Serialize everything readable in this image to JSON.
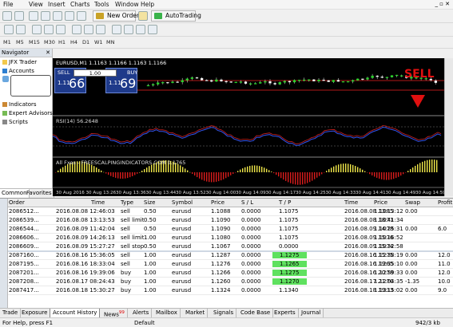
{
  "menu": [
    "File",
    "View",
    "Insert",
    "Charts",
    "Tools",
    "Window",
    "Help"
  ],
  "toolbar": {
    "new_order": "New Order",
    "autotrading": "AutoTrading",
    "timeframes": [
      "M1",
      "M5",
      "M15",
      "M30",
      "H1",
      "H4",
      "D1",
      "W1",
      "MN"
    ]
  },
  "navigator": {
    "title": "Navigator",
    "items": [
      "JFX Trader",
      "Accounts",
      "Indicators",
      "Expert Advisors",
      "Scripts"
    ],
    "tabs": [
      "Common",
      "Favorites"
    ]
  },
  "chart": {
    "title": "EURUSD,M1  1.1163 1.1166 1.1163 1.1166",
    "sell_label": "SELL",
    "buy_label": "BUY",
    "lot": "1.00",
    "sell_small": "1.11",
    "sell_big": "66",
    "buy_small": "1.11",
    "buy_big": "69",
    "signal_text": "SELL",
    "rsi_label": "RSI(14) 56.2648",
    "ind_label": "All Fxes - FREESCALPINGINDICATORS.COM  0.1765",
    "time_labels": [
      "30 Aug 2016",
      "30 Aug 13:26",
      "30 Aug 13:36",
      "30 Aug 13:44",
      "30 Aug 13:52",
      "30 Aug 14:00",
      "30 Aug 14:09",
      "30 Aug 14:17",
      "30 Aug 14:25",
      "30 Aug 14:33",
      "30 Aug 14:41",
      "30 Aug 14:49",
      "30 Aug 14:59"
    ],
    "accent_up": "#2bd52b",
    "accent_down": "#e01010",
    "signal_color": "#e01010"
  },
  "terminal": {
    "columns": [
      "Order",
      "Time",
      "Type",
      "Size",
      "Symbol",
      "Price",
      "S / L",
      "T / P",
      "Time",
      "Price",
      "Swap",
      "Profit"
    ],
    "rows": [
      [
        "2086512...",
        "2016.08.08 12:46:03",
        "sell",
        "0.50",
        "eurusd",
        "1.1088",
        "0.0000",
        "1.1075",
        "2016.08.08 13:13:12",
        "1.1085",
        "0.00",
        ""
      ],
      [
        "2086539...",
        "2016.08.08 13:13:53",
        "sell limit",
        "0.50",
        "eurusd",
        "1.1090",
        "0.0000",
        "1.1075",
        "2016.08.08 18:41:34",
        "1.1071",
        "",
        ""
      ],
      [
        "2086544...",
        "2016.08.09 11:42:04",
        "sell",
        "0.50",
        "eurusd",
        "1.1090",
        "0.0000",
        "1.1075",
        "2016.08.09 14:25:31",
        "1.1078",
        "0.00",
        "6.0"
      ],
      [
        "2086606...",
        "2016.08.09 14:26:13",
        "sell limit",
        "1.00",
        "eurusd",
        "1.1080",
        "0.0000",
        "1.1075",
        "2016.08.09 15:16:52",
        "1.1076",
        "",
        ""
      ],
      [
        "2086609...",
        "2016.08.09 15:27:27",
        "sell stop",
        "0.50",
        "eurusd",
        "1.1067",
        "0.0000",
        "0.0000",
        "2016.08.09 15:32:58",
        "1.1074",
        "",
        ""
      ],
      [
        "2087160...",
        "2016.08.16 15:36:05",
        "sell",
        "1.00",
        "eurusd",
        "1.1287",
        "0.0000",
        "1.1275",
        "2016.08.16 15:38:19",
        "1.1275",
        "0.00",
        "12.0"
      ],
      [
        "2087195...",
        "2016.08.16 18:33:04",
        "sell",
        "1.00",
        "eurusd",
        "1.1276",
        "0.0000",
        "1.1265",
        "2016.08.16 19:35:10",
        "1.1265",
        "0.00",
        "11.0"
      ],
      [
        "2087201...",
        "2016.08.16 19:39:06",
        "buy",
        "1.00",
        "eurusd",
        "1.1266",
        "0.0000",
        "1.1275",
        "2016.08.16 20:59:33",
        "1.1278",
        "0.00",
        "12.0"
      ],
      [
        "2087208...",
        "2016.08.17 08:24:43",
        "buy",
        "1.00",
        "eurusd",
        "1.1260",
        "0.0000",
        "1.1270",
        "2016.08.17 21:04:35",
        "1.1270",
        "-1.35",
        "10.0"
      ],
      [
        "2087417...",
        "2016.08.18 15:30:27",
        "buy",
        "1.00",
        "eurusd",
        "1.1324",
        "0.0000",
        "1.1340",
        "2016.08.18 19:15:02",
        "1.1333",
        "0.00",
        "9.0"
      ]
    ],
    "highlight_tp_rows": [
      5,
      6,
      7,
      8
    ],
    "tabs": [
      "Trade",
      "Exposure",
      "Account History",
      "News",
      "Alerts",
      "Mailbox",
      "Market",
      "Signals",
      "Code Base",
      "Experts",
      "Journal"
    ],
    "news_badge": "99"
  },
  "status": {
    "left": "For Help, press F1",
    "mid": "Default",
    "right": "942/3 kb"
  }
}
